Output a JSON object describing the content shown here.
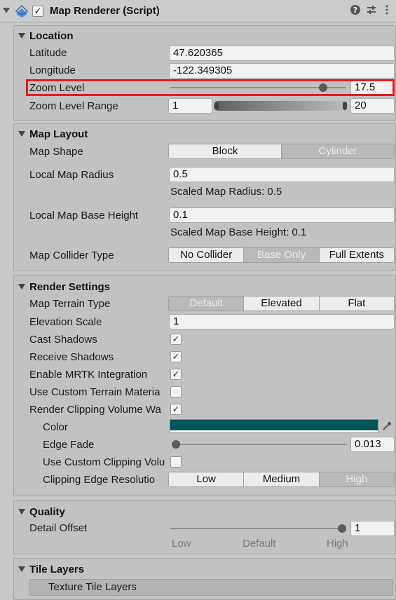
{
  "header": {
    "title": "Map Renderer (Script)",
    "enabled_mark": "✓"
  },
  "location": {
    "title": "Location",
    "latitude_label": "Latitude",
    "latitude_value": "47.620365",
    "longitude_label": "Longitude",
    "longitude_value": "-122.349305",
    "zoom_label": "Zoom Level",
    "zoom_value": "17.5",
    "zoom_range_label": "Zoom Level Range",
    "zoom_min": "1",
    "zoom_max": "20"
  },
  "map_layout": {
    "title": "Map Layout",
    "shape_label": "Map Shape",
    "shape_options": [
      "Block",
      "Cylinder"
    ],
    "radius_label": "Local Map Radius",
    "radius_value": "0.5",
    "scaled_radius": "Scaled Map Radius: 0.5",
    "base_height_label": "Local Map Base Height",
    "base_height_value": "0.1",
    "scaled_base_height": "Scaled Map Base Height: 0.1",
    "collider_label": "Map Collider Type",
    "collider_options": [
      "No Collider",
      "Base Only",
      "Full Extents"
    ]
  },
  "render_settings": {
    "title": "Render Settings",
    "terrain_label": "Map Terrain Type",
    "terrain_options": [
      "Default",
      "Elevated",
      "Flat"
    ],
    "elevation_label": "Elevation Scale",
    "elevation_value": "1",
    "cast_shadows_label": "Cast Shadows",
    "receive_shadows_label": "Receive Shadows",
    "mrtk_label": "Enable MRTK Integration",
    "custom_terrain_label": "Use Custom Terrain Materia",
    "clipping_wall_label": "Render Clipping Volume Wa",
    "color_label": "Color",
    "edge_fade_label": "Edge Fade",
    "edge_fade_value": "0.013",
    "custom_clipping_label": "Use Custom Clipping Volu",
    "edge_resolution_label": "Clipping Edge Resolutio",
    "edge_resolution_options": [
      "Low",
      "Medium",
      "High"
    ],
    "check_mark": "✓"
  },
  "quality": {
    "title": "Quality",
    "detail_label": "Detail Offset",
    "detail_value": "1",
    "ticks": [
      "Low",
      "Default",
      "High"
    ]
  },
  "tile_layers": {
    "title": "Tile Layers",
    "texture_label": "Texture Tile Layers"
  },
  "colors": {
    "highlight": "#e31b23",
    "clip_color": "#00555a"
  },
  "values": {
    "zoom_fraction": 0.87,
    "edge_fade_fraction": 0.0,
    "detail_fraction": 1.0
  }
}
